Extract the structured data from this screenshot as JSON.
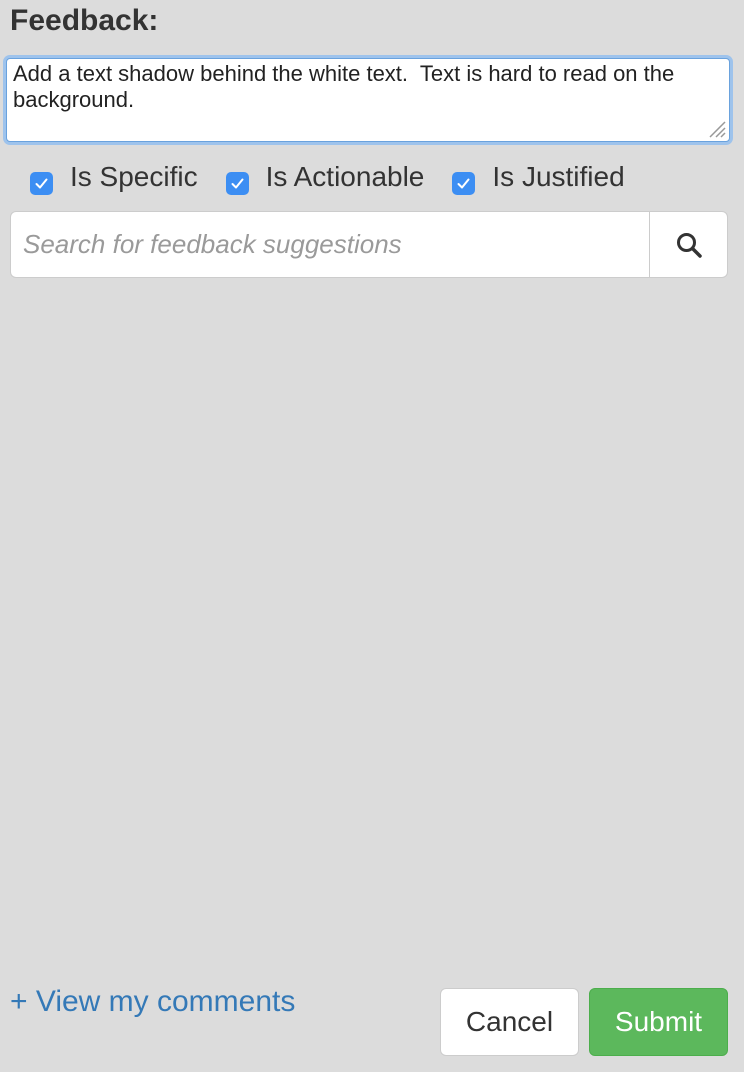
{
  "feedback": {
    "heading": "Feedback:",
    "text": "Add a text shadow behind the white text.  Text is hard to read on the background."
  },
  "criteria": [
    {
      "label": "Is Specific",
      "checked": true
    },
    {
      "label": "Is Actionable",
      "checked": true
    },
    {
      "label": "Is Justified",
      "checked": true
    }
  ],
  "search": {
    "placeholder": "Search for feedback suggestions",
    "icon": "search-icon"
  },
  "footer": {
    "view_comments": "+ View my comments",
    "cancel_label": "Cancel",
    "submit_label": "Submit"
  },
  "colors": {
    "checkbox": "#3c8ef3",
    "link": "#3479b7",
    "submit": "#5cb85c",
    "focus_ring": "#9ec3ec"
  }
}
